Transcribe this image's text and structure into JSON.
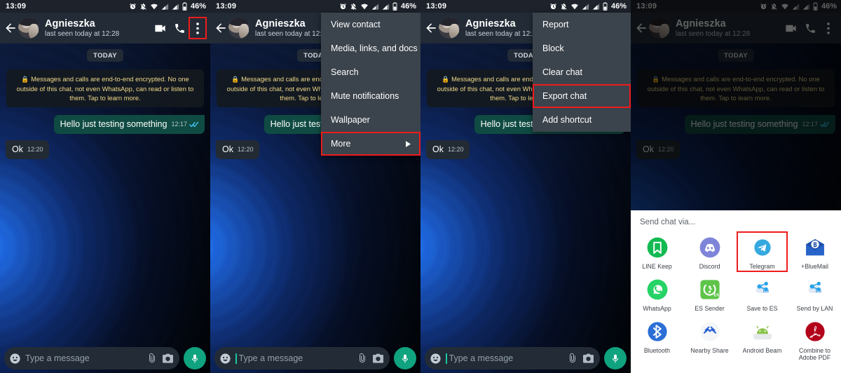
{
  "statusbar": {
    "time": "13:09",
    "battery": "46%",
    "icons": [
      "alarm-icon",
      "notifications-muted-icon",
      "wifi-icon",
      "signal-sim1-icon",
      "signal-sim2-icon",
      "battery-icon"
    ]
  },
  "header": {
    "contact_name": "Agnieszka",
    "last_seen": "last seen today at 12:28",
    "video_call_label": "Video call",
    "voice_call_label": "Voice call",
    "overflow_label": "More options"
  },
  "chat": {
    "day_divider": "TODAY",
    "encryption_notice": "Messages and calls are end-to-end encrypted. No one outside of this chat, not even WhatsApp, can read or listen to them. Tap to learn more.",
    "messages": [
      {
        "text": "Hello just testing something",
        "time": "12:17",
        "direction": "out",
        "status": "read"
      },
      {
        "text": "Ok",
        "time": "12:20",
        "direction": "in",
        "status": "none"
      }
    ]
  },
  "composer": {
    "placeholder": "Type a message",
    "emoji_label": "Emoji",
    "attach_label": "Attach",
    "camera_label": "Camera",
    "mic_label": "Voice message"
  },
  "menu_main": {
    "items": [
      {
        "label": "View contact",
        "highlighted": false,
        "submenu": false
      },
      {
        "label": "Media, links, and docs",
        "highlighted": false,
        "submenu": false
      },
      {
        "label": "Search",
        "highlighted": false,
        "submenu": false
      },
      {
        "label": "Mute notifications",
        "highlighted": false,
        "submenu": false
      },
      {
        "label": "Wallpaper",
        "highlighted": false,
        "submenu": false
      },
      {
        "label": "More",
        "highlighted": true,
        "submenu": true
      }
    ]
  },
  "menu_more": {
    "items": [
      {
        "label": "Report",
        "highlighted": false
      },
      {
        "label": "Block",
        "highlighted": false
      },
      {
        "label": "Clear chat",
        "highlighted": false
      },
      {
        "label": "Export chat",
        "highlighted": true
      },
      {
        "label": "Add shortcut",
        "highlighted": false
      }
    ]
  },
  "share_sheet": {
    "title": "Send chat via...",
    "apps": [
      {
        "label": "LINE Keep",
        "icon": "line-keep-icon",
        "highlighted": false
      },
      {
        "label": "Discord",
        "icon": "discord-icon",
        "highlighted": false
      },
      {
        "label": "Telegram",
        "icon": "telegram-icon",
        "highlighted": true
      },
      {
        "label": "+BlueMail",
        "icon": "bluemail-icon",
        "highlighted": false
      },
      {
        "label": "WhatsApp",
        "icon": "whatsapp-icon",
        "highlighted": false
      },
      {
        "label": "ES Sender",
        "icon": "es-sender-icon",
        "highlighted": false
      },
      {
        "label": "Save to ES",
        "icon": "save-to-es-icon",
        "highlighted": false
      },
      {
        "label": "Send by LAN",
        "icon": "send-by-lan-icon",
        "highlighted": false
      },
      {
        "label": "Bluetooth",
        "icon": "bluetooth-icon",
        "highlighted": false
      },
      {
        "label": "Nearby Share",
        "icon": "nearby-share-icon",
        "highlighted": false
      },
      {
        "label": "Android Beam",
        "icon": "android-beam-icon",
        "highlighted": false
      },
      {
        "label": "Combine to Adobe PDF",
        "icon": "adobe-pdf-icon",
        "highlighted": false
      }
    ]
  },
  "colors": {
    "appbar": "#222b36",
    "statusbar": "#1d222b",
    "outgoing_bubble": "#0f4b42",
    "incoming_bubble": "#222a33",
    "highlight_red": "#ee1c1c",
    "mic_green": "#0fa37f",
    "menu_bg": "#3b434c",
    "encryption_text": "#f0d98a"
  }
}
